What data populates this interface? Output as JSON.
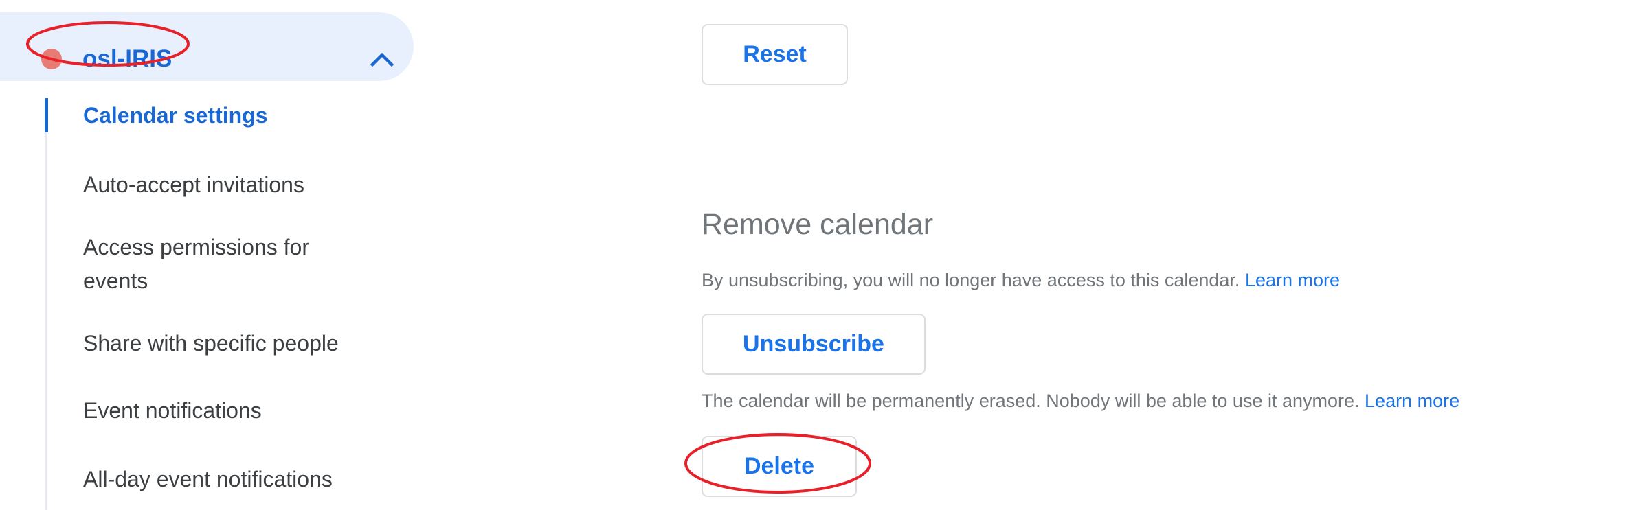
{
  "sidebar": {
    "calendar": {
      "name": "osl-IRIS",
      "color": "#e67c73",
      "expanded": true,
      "toggle_icon": "chevron-up-icon"
    },
    "items": [
      {
        "label": "Calendar settings",
        "active": true
      },
      {
        "label": "Auto-accept invitations",
        "active": false
      },
      {
        "label": "Access permissions for events",
        "active": false
      },
      {
        "label": "Share with specific people",
        "active": false
      },
      {
        "label": "Event notifications",
        "active": false
      },
      {
        "label": "All-day event notifications",
        "active": false
      }
    ]
  },
  "main": {
    "reset_label": "Reset",
    "remove_section": {
      "title": "Remove calendar",
      "unsubscribe_description": "By unsubscribing, you will no longer have access to this calendar.",
      "unsubscribe_link": "Learn more",
      "unsubscribe_label": "Unsubscribe",
      "delete_description": "The calendar will be permanently erased. Nobody will be able to use it anymore.",
      "delete_link": "Learn more",
      "delete_label": "Delete"
    }
  },
  "annotations": [
    {
      "target": "calendar-name",
      "shape": "ellipse",
      "color": "#e8202a"
    },
    {
      "target": "delete-button",
      "shape": "ellipse",
      "color": "#e8202a"
    }
  ],
  "colors": {
    "accent": "#1a73e8",
    "active_nav": "#1967d2",
    "pill_background": "#e8f0fe",
    "secondary_text": "#70757a",
    "primary_text": "#3c4043",
    "border": "#dadce0"
  }
}
